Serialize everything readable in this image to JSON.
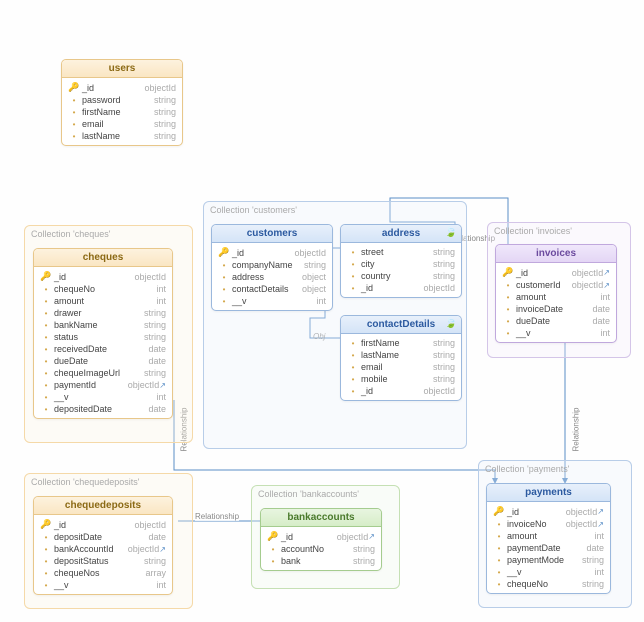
{
  "collections": {
    "users": {
      "title": "users",
      "fields": [
        {
          "icon": "key",
          "name": "_id",
          "type": "objectId"
        },
        {
          "icon": "dot",
          "name": "password",
          "type": "string"
        },
        {
          "icon": "dot",
          "name": "firstName",
          "type": "string"
        },
        {
          "icon": "dot",
          "name": "email",
          "type": "string"
        },
        {
          "icon": "dot",
          "name": "lastName",
          "type": "string"
        }
      ]
    },
    "cheques": {
      "label": "Collection 'cheques'",
      "title": "cheques",
      "fields": [
        {
          "icon": "key",
          "name": "_id",
          "type": "objectId"
        },
        {
          "icon": "dot",
          "name": "chequeNo",
          "type": "int"
        },
        {
          "icon": "dot",
          "name": "amount",
          "type": "int"
        },
        {
          "icon": "dot",
          "name": "drawer",
          "type": "string"
        },
        {
          "icon": "dot",
          "name": "bankName",
          "type": "string"
        },
        {
          "icon": "dot",
          "name": "status",
          "type": "string"
        },
        {
          "icon": "dot",
          "name": "receivedDate",
          "type": "date"
        },
        {
          "icon": "dot",
          "name": "dueDate",
          "type": "date"
        },
        {
          "icon": "dot",
          "name": "chequeImageUrl",
          "type": "string"
        },
        {
          "icon": "dot",
          "name": "paymentId",
          "type": "objectId",
          "ref": true
        },
        {
          "icon": "dot",
          "name": "__v",
          "type": "int"
        },
        {
          "icon": "dot",
          "name": "depositedDate",
          "type": "date"
        }
      ]
    },
    "customers": {
      "label": "Collection 'customers'",
      "title": "customers",
      "fields": [
        {
          "icon": "key",
          "name": "_id",
          "type": "objectId"
        },
        {
          "icon": "dot",
          "name": "companyName",
          "type": "string"
        },
        {
          "icon": "dot",
          "name": "address",
          "type": "object"
        },
        {
          "icon": "dot",
          "name": "contactDetails",
          "type": "object"
        },
        {
          "icon": "dot",
          "name": "__v",
          "type": "int"
        }
      ]
    },
    "address": {
      "title": "address",
      "fields": [
        {
          "icon": "dot",
          "name": "street",
          "type": "string"
        },
        {
          "icon": "dot",
          "name": "city",
          "type": "string"
        },
        {
          "icon": "dot",
          "name": "country",
          "type": "string"
        },
        {
          "icon": "dot",
          "name": "_id",
          "type": "objectId"
        }
      ]
    },
    "contactDetails": {
      "title": "contactDetails",
      "fields": [
        {
          "icon": "dot",
          "name": "firstName",
          "type": "string"
        },
        {
          "icon": "dot",
          "name": "lastName",
          "type": "string"
        },
        {
          "icon": "dot",
          "name": "email",
          "type": "string"
        },
        {
          "icon": "dot",
          "name": "mobile",
          "type": "string"
        },
        {
          "icon": "dot",
          "name": "_id",
          "type": "objectId"
        }
      ]
    },
    "invoices": {
      "label": "Collection 'invoices'",
      "title": "invoices",
      "fields": [
        {
          "icon": "key",
          "name": "_id",
          "type": "objectId",
          "ref": true
        },
        {
          "icon": "dot",
          "name": "customerId",
          "type": "objectId",
          "ref": true
        },
        {
          "icon": "dot",
          "name": "amount",
          "type": "int"
        },
        {
          "icon": "dot",
          "name": "invoiceDate",
          "type": "date"
        },
        {
          "icon": "dot",
          "name": "dueDate",
          "type": "date"
        },
        {
          "icon": "dot",
          "name": "__v",
          "type": "int"
        }
      ]
    },
    "chequedeposits": {
      "label": "Collection 'chequedeposits'",
      "title": "chequedeposits",
      "fields": [
        {
          "icon": "key",
          "name": "_id",
          "type": "objectId"
        },
        {
          "icon": "dot",
          "name": "depositDate",
          "type": "date"
        },
        {
          "icon": "dot",
          "name": "bankAccountId",
          "type": "objectId",
          "ref": true
        },
        {
          "icon": "dot",
          "name": "depositStatus",
          "type": "string"
        },
        {
          "icon": "dot",
          "name": "chequeNos",
          "type": "array"
        },
        {
          "icon": "dot",
          "name": "__v",
          "type": "int"
        }
      ]
    },
    "bankaccounts": {
      "label": "Collection 'bankaccounts'",
      "title": "bankaccounts",
      "fields": [
        {
          "icon": "key",
          "name": "_id",
          "type": "objectId",
          "ref": true
        },
        {
          "icon": "dot",
          "name": "accountNo",
          "type": "string"
        },
        {
          "icon": "dot",
          "name": "bank",
          "type": "string"
        }
      ]
    },
    "payments": {
      "label": "Collection 'payments'",
      "title": "payments",
      "fields": [
        {
          "icon": "key",
          "name": "_id",
          "type": "objectId",
          "ref": true
        },
        {
          "icon": "dot",
          "name": "invoiceNo",
          "type": "objectId",
          "ref": true
        },
        {
          "icon": "dot",
          "name": "amount",
          "type": "int"
        },
        {
          "icon": "dot",
          "name": "paymentDate",
          "type": "date"
        },
        {
          "icon": "dot",
          "name": "paymentMode",
          "type": "string"
        },
        {
          "icon": "dot",
          "name": "__v",
          "type": "int"
        },
        {
          "icon": "dot",
          "name": "chequeNo",
          "type": "string"
        }
      ]
    }
  },
  "relLabels": {
    "rel": "Relationship",
    "obj": "Obj"
  }
}
